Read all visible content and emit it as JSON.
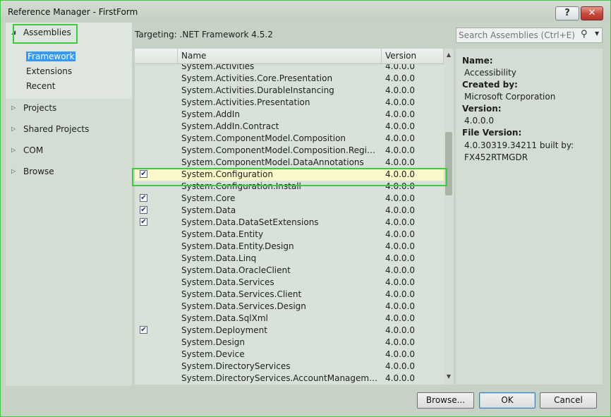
{
  "window": {
    "title": "Reference Manager - FirstForm",
    "help_label": "?",
    "close_label": "✕"
  },
  "nav": {
    "assemblies": "Assemblies",
    "sub_items": [
      "Framework",
      "Extensions",
      "Recent"
    ],
    "projects": "Projects",
    "shared_projects": "Shared Projects",
    "com": "COM",
    "browse": "Browse"
  },
  "targeting": "Targeting: .NET Framework 4.5.2",
  "search": {
    "placeholder": "Search Assemblies (Ctrl+E)"
  },
  "list": {
    "headers": {
      "name": "Name",
      "version": "Version"
    },
    "rows": [
      {
        "name": "System.Activities",
        "version": "4.0.0.0",
        "checked": false
      },
      {
        "name": "System.Activities.Core.Presentation",
        "version": "4.0.0.0",
        "checked": false
      },
      {
        "name": "System.Activities.DurableInstancing",
        "version": "4.0.0.0",
        "checked": false
      },
      {
        "name": "System.Activities.Presentation",
        "version": "4.0.0.0",
        "checked": false
      },
      {
        "name": "System.AddIn",
        "version": "4.0.0.0",
        "checked": false
      },
      {
        "name": "System.AddIn.Contract",
        "version": "4.0.0.0",
        "checked": false
      },
      {
        "name": "System.ComponentModel.Composition",
        "version": "4.0.0.0",
        "checked": false
      },
      {
        "name": "System.ComponentModel.Composition.Regist...",
        "version": "4.0.0.0",
        "checked": false
      },
      {
        "name": "System.ComponentModel.DataAnnotations",
        "version": "4.0.0.0",
        "checked": false
      },
      {
        "name": "System.Configuration",
        "version": "4.0.0.0",
        "checked": true
      },
      {
        "name": "System.Configuration.Install",
        "version": "4.0.0.0",
        "checked": false
      },
      {
        "name": "System.Core",
        "version": "4.0.0.0",
        "checked": true
      },
      {
        "name": "System.Data",
        "version": "4.0.0.0",
        "checked": true
      },
      {
        "name": "System.Data.DataSetExtensions",
        "version": "4.0.0.0",
        "checked": true
      },
      {
        "name": "System.Data.Entity",
        "version": "4.0.0.0",
        "checked": false
      },
      {
        "name": "System.Data.Entity.Design",
        "version": "4.0.0.0",
        "checked": false
      },
      {
        "name": "System.Data.Linq",
        "version": "4.0.0.0",
        "checked": false
      },
      {
        "name": "System.Data.OracleClient",
        "version": "4.0.0.0",
        "checked": false
      },
      {
        "name": "System.Data.Services",
        "version": "4.0.0.0",
        "checked": false
      },
      {
        "name": "System.Data.Services.Client",
        "version": "4.0.0.0",
        "checked": false
      },
      {
        "name": "System.Data.Services.Design",
        "version": "4.0.0.0",
        "checked": false
      },
      {
        "name": "System.Data.SqlXml",
        "version": "4.0.0.0",
        "checked": false
      },
      {
        "name": "System.Deployment",
        "version": "4.0.0.0",
        "checked": true
      },
      {
        "name": "System.Design",
        "version": "4.0.0.0",
        "checked": false
      },
      {
        "name": "System.Device",
        "version": "4.0.0.0",
        "checked": false
      },
      {
        "name": "System.DirectoryServices",
        "version": "4.0.0.0",
        "checked": false
      },
      {
        "name": "System.DirectoryServices.AccountManagement",
        "version": "4.0.0.0",
        "checked": false
      }
    ],
    "selected_index": 9
  },
  "details": {
    "name_label": "Name:",
    "name_value": "Accessibility",
    "created_label": "Created by:",
    "created_value": "Microsoft Corporation",
    "version_label": "Version:",
    "version_value": "4.0.0.0",
    "file_version_label": "File Version:",
    "file_version_value": "4.0.30319.34211 built by: FX452RTMGDR"
  },
  "buttons": {
    "browse": "Browse...",
    "ok": "OK",
    "cancel": "Cancel"
  }
}
